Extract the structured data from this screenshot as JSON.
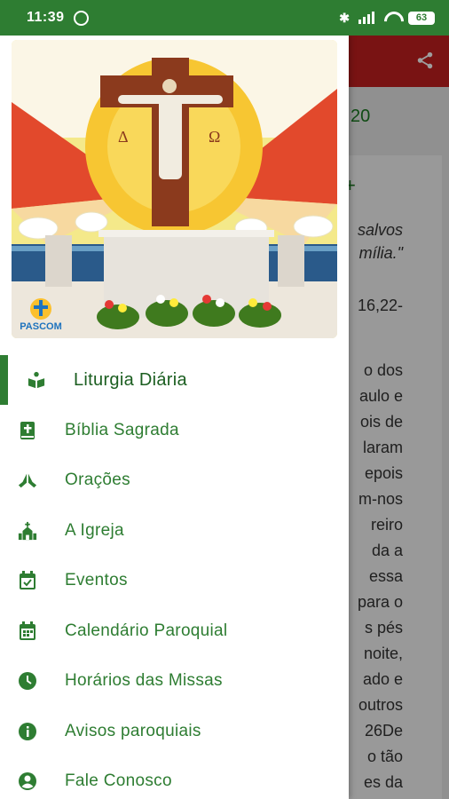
{
  "status_bar": {
    "time": "11:39",
    "battery": "63"
  },
  "drawer": {
    "header_logo_text": "PASCOM",
    "menu": [
      {
        "label": "Liturgia Diária",
        "icon": "open-book-icon",
        "active": true
      },
      {
        "label": "Bíblia Sagrada",
        "icon": "bible-icon",
        "active": false
      },
      {
        "label": "Orações",
        "icon": "praying-hands-icon",
        "active": false
      },
      {
        "label": "A Igreja",
        "icon": "church-icon",
        "active": false
      },
      {
        "label": "Eventos",
        "icon": "calendar-check-icon",
        "active": false
      },
      {
        "label": "Calendário Paroquial",
        "icon": "calendar-icon",
        "active": false
      },
      {
        "label": "Horários das Missas",
        "icon": "clock-icon",
        "active": false
      },
      {
        "label": "Avisos paroquiais",
        "icon": "info-icon",
        "active": false
      },
      {
        "label": "Fale Conosco",
        "icon": "account-icon",
        "active": false
      }
    ]
  },
  "background": {
    "date_fragment": "20",
    "plus_glyph": "+",
    "lines": [
      "salvos",
      "mília.\"",
      "16,22-",
      "o dos",
      "aulo e",
      "ois de",
      "laram",
      "epois",
      "m-nos",
      "reiro",
      "da a",
      "essa",
      "para o",
      "s pés",
      "noite,",
      "ado e",
      "outros",
      "26De",
      "o tão",
      "es da"
    ]
  },
  "colors": {
    "status_bar": "#2e7d32",
    "app_bar": "#c41f1f",
    "menu_text": "#2e7d32",
    "accent": "#2e7d32"
  }
}
